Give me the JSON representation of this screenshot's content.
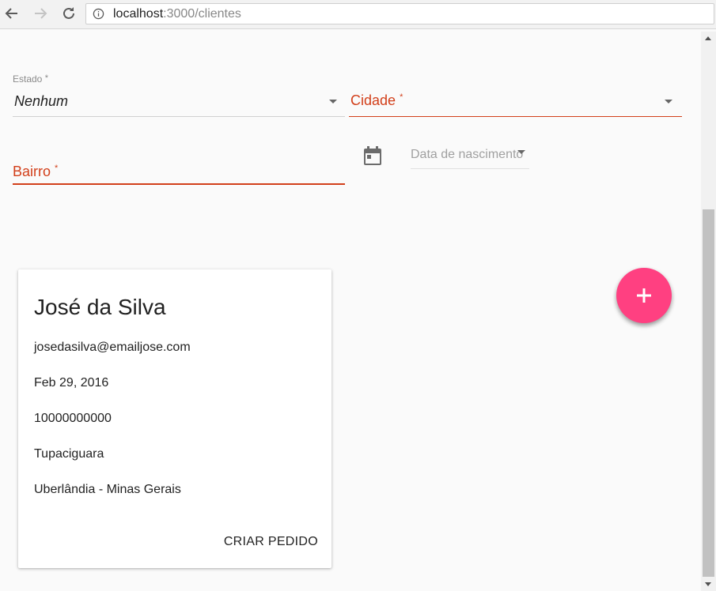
{
  "browser": {
    "url_host": "localhost",
    "url_path": ":3000/clientes"
  },
  "form": {
    "estado_label": "Estado",
    "estado_required": "*",
    "estado_value": "Nenhum",
    "cidade_label": "Cidade",
    "cidade_required": "*",
    "bairro_label": "Bairro",
    "bairro_required": "*",
    "date_placeholder": "Data de nascimento"
  },
  "card": {
    "name": "José da Silva",
    "email": "josedasilva@emailjose.com",
    "birth_date": "Feb 29, 2016",
    "phone": "10000000000",
    "district": "Tupaciguara",
    "city_state": "Uberlândia - Minas Gerais",
    "action_label": "CRIAR PEDIDO"
  },
  "colors": {
    "error": "#d23f1a",
    "fab": "#ff4081"
  },
  "icons": {
    "back": "arrow-left-icon",
    "forward": "arrow-right-icon",
    "reload": "reload-icon",
    "info": "info-icon",
    "calendar": "calendar-icon",
    "add": "plus-icon"
  }
}
